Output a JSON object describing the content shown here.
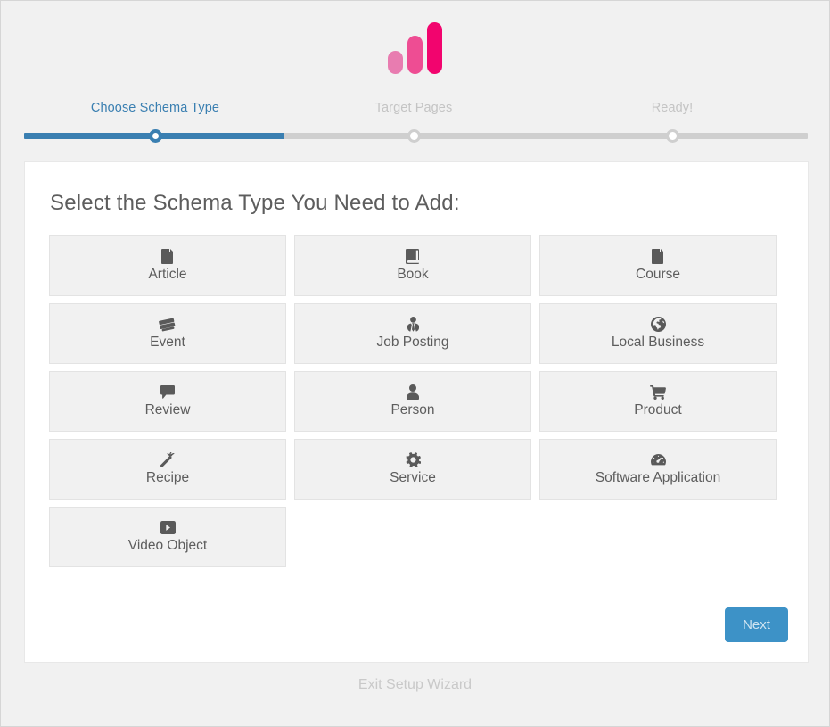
{
  "brand": {
    "logo_name": "analytics-bars-logo",
    "bar_colors": [
      "#e87cb0",
      "#ee4d93",
      "#f2046e"
    ]
  },
  "theme": {
    "accent_blue": "#3a7fb1",
    "button_blue": "#3d92c7",
    "inactive_gray": "#c4c4c4",
    "page_background": "#f1f1f1",
    "card_background": "#ffffff"
  },
  "wizard": {
    "steps": [
      {
        "label": "Choose Schema Type",
        "state": "active"
      },
      {
        "label": "Target Pages",
        "state": "inactive"
      },
      {
        "label": "Ready!",
        "state": "inactive"
      }
    ]
  },
  "main": {
    "heading": "Select the Schema Type You Need to Add:",
    "schema_types": [
      {
        "label": "Article",
        "icon": "file-icon"
      },
      {
        "label": "Book",
        "icon": "book-icon"
      },
      {
        "label": "Course",
        "icon": "file-icon"
      },
      {
        "label": "Event",
        "icon": "tickets-icon"
      },
      {
        "label": "Job Posting",
        "icon": "user-tie-icon"
      },
      {
        "label": "Local Business",
        "icon": "globe-icon"
      },
      {
        "label": "Review",
        "icon": "comment-icon"
      },
      {
        "label": "Person",
        "icon": "user-icon"
      },
      {
        "label": "Product",
        "icon": "shopping-cart-icon"
      },
      {
        "label": "Recipe",
        "icon": "carrot-icon"
      },
      {
        "label": "Service",
        "icon": "gear-icon"
      },
      {
        "label": "Software Application",
        "icon": "tachometer-icon"
      },
      {
        "label": "Video Object",
        "icon": "play-square-icon"
      }
    ],
    "next_label": "Next"
  },
  "footer": {
    "exit_label": "Exit Setup Wizard"
  }
}
